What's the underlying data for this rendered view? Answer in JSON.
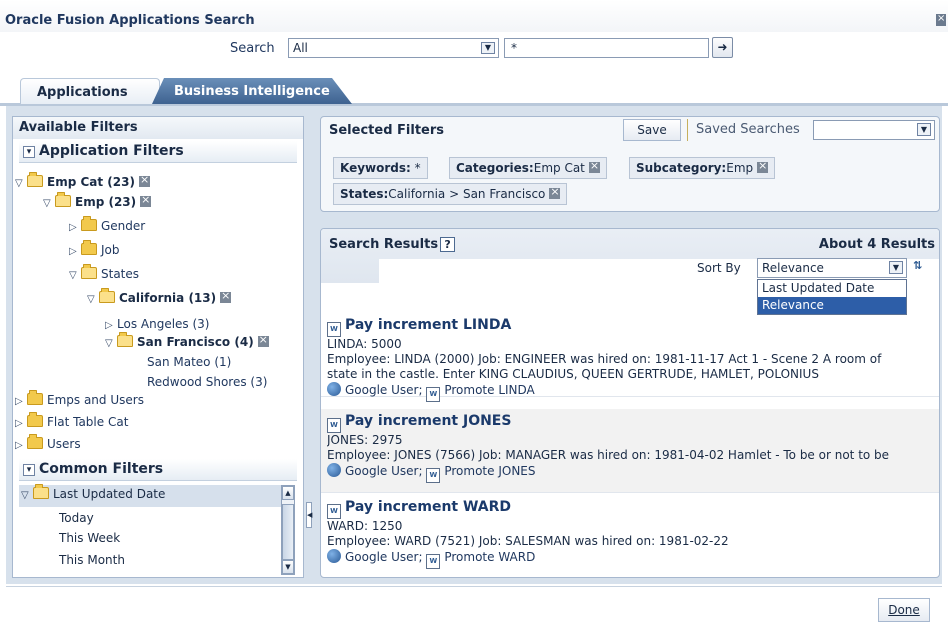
{
  "dialog": {
    "title": "Oracle Fusion Applications Search"
  },
  "search": {
    "label": "Search",
    "scope": "All",
    "keyword": "*"
  },
  "tabs": [
    {
      "label": "Applications",
      "active": true
    },
    {
      "label": "Business Intelligence",
      "active": false
    }
  ],
  "left": {
    "title": "Available Filters",
    "app_filters_title": "Application Filters",
    "tree": [
      {
        "label": "Emp Cat (23)",
        "bold": true,
        "expanded": true,
        "folder": true,
        "removable": true
      },
      {
        "label": "Emp (23)",
        "bold": true,
        "expanded": true,
        "folder": true,
        "removable": true
      },
      {
        "label": "Gender",
        "folder": true,
        "expanded": false
      },
      {
        "label": "Job",
        "folder": true,
        "expanded": false
      },
      {
        "label": "States",
        "folder": true,
        "expanded": true
      },
      {
        "label": "California (13)",
        "bold": true,
        "expanded": true,
        "folder": true,
        "removable": true
      },
      {
        "label": "Los Angeles (3)",
        "expanded": false
      },
      {
        "label": "San Francisco (4)",
        "bold": true,
        "expanded": true,
        "folder": true,
        "removable": true
      },
      {
        "label": "San Mateo (1)"
      },
      {
        "label": "Redwood Shores (3)"
      },
      {
        "label": "Emps and Users",
        "folder": true,
        "expanded": false
      },
      {
        "label": "Flat Table Cat",
        "folder": true,
        "expanded": false
      },
      {
        "label": "Users",
        "folder": true,
        "expanded": false
      }
    ],
    "common_filters_title": "Common Filters",
    "common": {
      "group": "Last Updated Date",
      "items": [
        "Today",
        "This Week",
        "This Month"
      ]
    }
  },
  "selected": {
    "title": "Selected Filters",
    "save_label": "Save",
    "saved_searches_label": "Saved Searches",
    "chips": [
      {
        "key": "Keywords:",
        "value": "*"
      },
      {
        "key": "Categories:",
        "value": "Emp Cat"
      },
      {
        "key": "Subcategory:",
        "value": "Emp"
      },
      {
        "key": "States:",
        "value": "California > San Francisco"
      }
    ]
  },
  "results": {
    "title": "Search Results",
    "help": "?",
    "count": "About 4 Results",
    "sortby_label": "Sort By",
    "sortby_value": "Relevance",
    "sort_options": [
      "Last Updated Date",
      "Relevance"
    ],
    "items": [
      {
        "title": "Pay increment LINDA",
        "line1": "LINDA: 5000",
        "line2": "Employee: LINDA (2000) Job: ENGINEER was hired on: 1981-11-17 Act 1 - Scene 2 A room of",
        "line3": "state in the castle. Enter KING CLAUDIUS, QUEEN GERTRUDE, HAMLET, POLONIUS",
        "link1": "Google User;",
        "link2": "Promote LINDA"
      },
      {
        "title": "Pay increment JONES",
        "line1": "JONES: 2975",
        "line2": "Employee: JONES (7566) Job: MANAGER was hired on: 1981-04-02 Hamlet - To be or not to be",
        "line3": "",
        "link1": "Google User;",
        "link2": "Promote JONES"
      },
      {
        "title": "Pay increment WARD",
        "line1": "WARD: 1250",
        "line2": "Employee: WARD (7521) Job: SALESMAN was hired on: 1981-02-22",
        "line3": "",
        "link1": "Google User;",
        "link2": "Promote WARD"
      }
    ]
  },
  "footer": {
    "done_label": "Done"
  },
  "colors": {
    "accent": "#2d5ea8",
    "tab_active_bg": "#3e6290",
    "panel_bg": "#d7e1ec"
  }
}
